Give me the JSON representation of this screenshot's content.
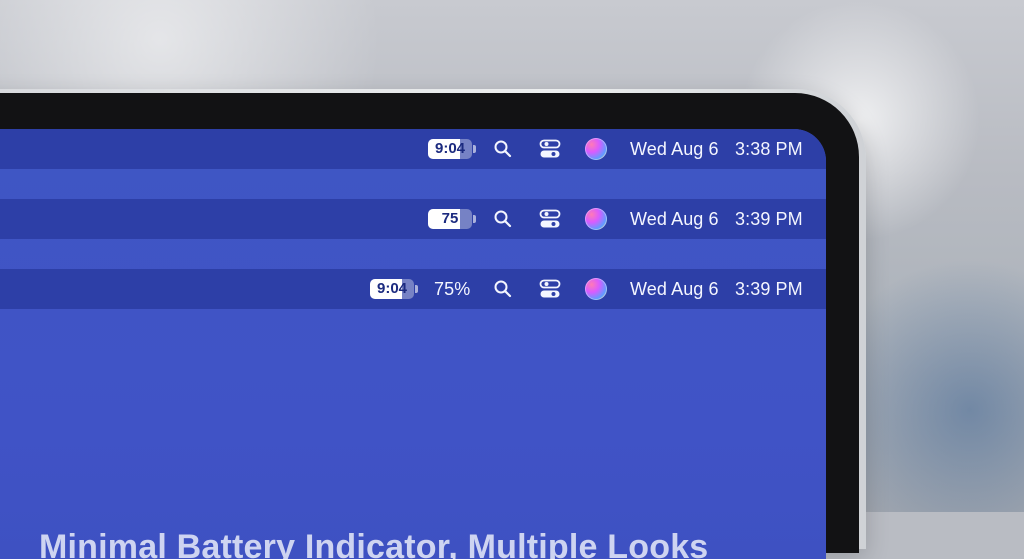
{
  "menubar_rows": [
    {
      "battery_label": "9:04",
      "battery_level_percent": 73,
      "show_percent": false,
      "date": "Wed Aug 6",
      "time": "3:38 PM"
    },
    {
      "battery_label": "75",
      "battery_level_percent": 73,
      "show_percent": false,
      "date": "Wed Aug 6",
      "time": "3:39 PM"
    },
    {
      "battery_label": "9:04",
      "battery_level_percent": 73,
      "show_percent": true,
      "percent_text": "75%",
      "date": "Wed Aug 6",
      "time": "3:39 PM"
    }
  ],
  "icons": {
    "search": "search-icon",
    "control_center": "control-center-icon",
    "siri": "siri-icon"
  },
  "caption": "Minimal Battery Indicator, Multiple Looks",
  "colors": {
    "screen": "#4053c6",
    "menubar": "#2d3fa7",
    "text": "#f4f6ff",
    "battery_text": "#1b2a7f",
    "caption": "#e6eaf8"
  }
}
